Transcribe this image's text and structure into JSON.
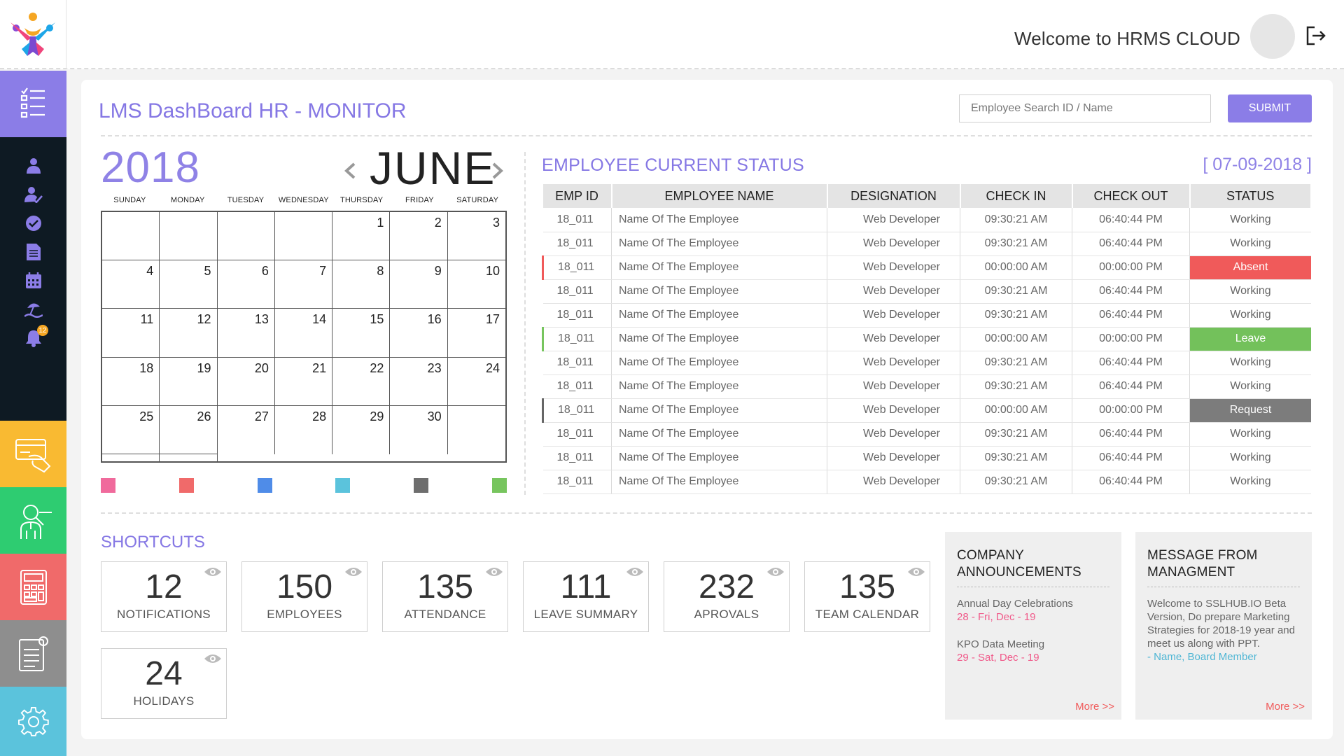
{
  "header": {
    "welcome": "Welcome to HRMS CLOUD",
    "logout_icon": "logout-icon"
  },
  "sidebar": {
    "active": "dashboard-list-icon",
    "items": [
      "user-icon",
      "user-check-icon",
      "check-circle-icon",
      "document-icon",
      "calendar-icon",
      "beach-icon",
      "bell-icon"
    ],
    "notification_badge": "12",
    "tiles": [
      "payroll-icon",
      "recruitment-icon",
      "calculator-icon",
      "reports-icon",
      "settings-icon"
    ]
  },
  "page": {
    "title": "LMS DashBoard HR - MONITOR",
    "search_placeholder": "Employee Search ID / Name",
    "submit_label": "SUBMIT"
  },
  "calendar": {
    "year": "2018",
    "month": "JUNE",
    "weekdays": [
      "SUNDAY",
      "MONDAY",
      "TUESDAY",
      "WEDNESDAY",
      "THURSDAY",
      "FRIDAY",
      "SATURDAY"
    ],
    "days": [
      "",
      "",
      "",
      "",
      "1",
      "2",
      "3",
      "4",
      "5",
      "6",
      "7",
      "8",
      "9",
      "10",
      "11",
      "12",
      "13",
      "14",
      "15",
      "16",
      "17",
      "18",
      "19",
      "20",
      "21",
      "22",
      "23",
      "24",
      "25",
      "26",
      "27",
      "28",
      "29",
      "30",
      "",
      "",
      ""
    ],
    "legend_colors": [
      "#f06a9c",
      "#f06a6a",
      "#4f8ce8",
      "#5bc3dc",
      "#6e6e6e",
      "#77c55e"
    ]
  },
  "status": {
    "title": "EMPLOYEE CURRENT STATUS",
    "date": "[ 07-09-2018 ]",
    "columns": [
      "EMP ID",
      "EMPLOYEE NAME",
      "DESIGNATION",
      "CHECK IN",
      "CHECK OUT",
      "STATUS"
    ],
    "rows": [
      {
        "id": "18_011",
        "name": "Name Of The Employee",
        "designation": "Web Developer",
        "in": "09:30:21 AM",
        "out": "06:40:44 PM",
        "status": "Working",
        "kind": "working"
      },
      {
        "id": "18_011",
        "name": "Name Of The Employee",
        "designation": "Web Developer",
        "in": "09:30:21 AM",
        "out": "06:40:44 PM",
        "status": "Working",
        "kind": "working"
      },
      {
        "id": "18_011",
        "name": "Name Of The Employee",
        "designation": "Web Developer",
        "in": "00:00:00 AM",
        "out": "00:00:00 PM",
        "status": "Absent",
        "kind": "absent"
      },
      {
        "id": "18_011",
        "name": "Name Of The Employee",
        "designation": "Web Developer",
        "in": "09:30:21 AM",
        "out": "06:40:44 PM",
        "status": "Working",
        "kind": "working"
      },
      {
        "id": "18_011",
        "name": "Name Of The Employee",
        "designation": "Web Developer",
        "in": "09:30:21 AM",
        "out": "06:40:44 PM",
        "status": "Working",
        "kind": "working"
      },
      {
        "id": "18_011",
        "name": "Name Of The Employee",
        "designation": "Web Developer",
        "in": "00:00:00 AM",
        "out": "00:00:00 PM",
        "status": "Leave",
        "kind": "leave"
      },
      {
        "id": "18_011",
        "name": "Name Of The Employee",
        "designation": "Web Developer",
        "in": "09:30:21 AM",
        "out": "06:40:44 PM",
        "status": "Working",
        "kind": "working"
      },
      {
        "id": "18_011",
        "name": "Name Of The Employee",
        "designation": "Web Developer",
        "in": "09:30:21 AM",
        "out": "06:40:44 PM",
        "status": "Working",
        "kind": "working"
      },
      {
        "id": "18_011",
        "name": "Name Of The Employee",
        "designation": "Web Developer",
        "in": "00:00:00 AM",
        "out": "00:00:00 PM",
        "status": "Request",
        "kind": "request"
      },
      {
        "id": "18_011",
        "name": "Name Of The Employee",
        "designation": "Web Developer",
        "in": "09:30:21 AM",
        "out": "06:40:44 PM",
        "status": "Working",
        "kind": "working"
      },
      {
        "id": "18_011",
        "name": "Name Of The Employee",
        "designation": "Web Developer",
        "in": "09:30:21 AM",
        "out": "06:40:44 PM",
        "status": "Working",
        "kind": "working"
      },
      {
        "id": "18_011",
        "name": "Name Of The Employee",
        "designation": "Web Developer",
        "in": "09:30:21 AM",
        "out": "06:40:44 PM",
        "status": "Working",
        "kind": "working"
      }
    ]
  },
  "shortcuts": {
    "title": "SHORTCUTS",
    "items": [
      {
        "count": "12",
        "label": "NOTIFICATIONS"
      },
      {
        "count": "150",
        "label": "EMPLOYEES"
      },
      {
        "count": "135",
        "label": "ATTENDANCE"
      },
      {
        "count": "111",
        "label": "LEAVE SUMMARY"
      },
      {
        "count": "232",
        "label": "APROVALS"
      },
      {
        "count": "135",
        "label": "TEAM CALENDAR"
      },
      {
        "count": "24",
        "label": "HOLIDAYS"
      }
    ]
  },
  "announcements": {
    "title_line1": "COMPANY",
    "title_line2": "ANNOUNCEMENTS",
    "items": [
      {
        "text": "Annual Day Celebrations",
        "date": "28 - Fri, Dec - 19"
      },
      {
        "text": "KPO Data Meeting",
        "date": "29 - Sat, Dec - 19"
      }
    ],
    "more": "More >>"
  },
  "management": {
    "title_line1": "MESSAGE FROM",
    "title_line2": "MANAGMENT",
    "message": "Welcome to SSLHUB.IO Beta Version, Do prepare Marketing Strategies for 2018-19 year and meet us along with PPT.",
    "signature": "- Name, Board Member",
    "more": "More >>"
  },
  "colors": {
    "accent": "#8b7de7",
    "absent": "#f05a5a",
    "leave": "#73c15b",
    "request": "#7c7c7c"
  }
}
